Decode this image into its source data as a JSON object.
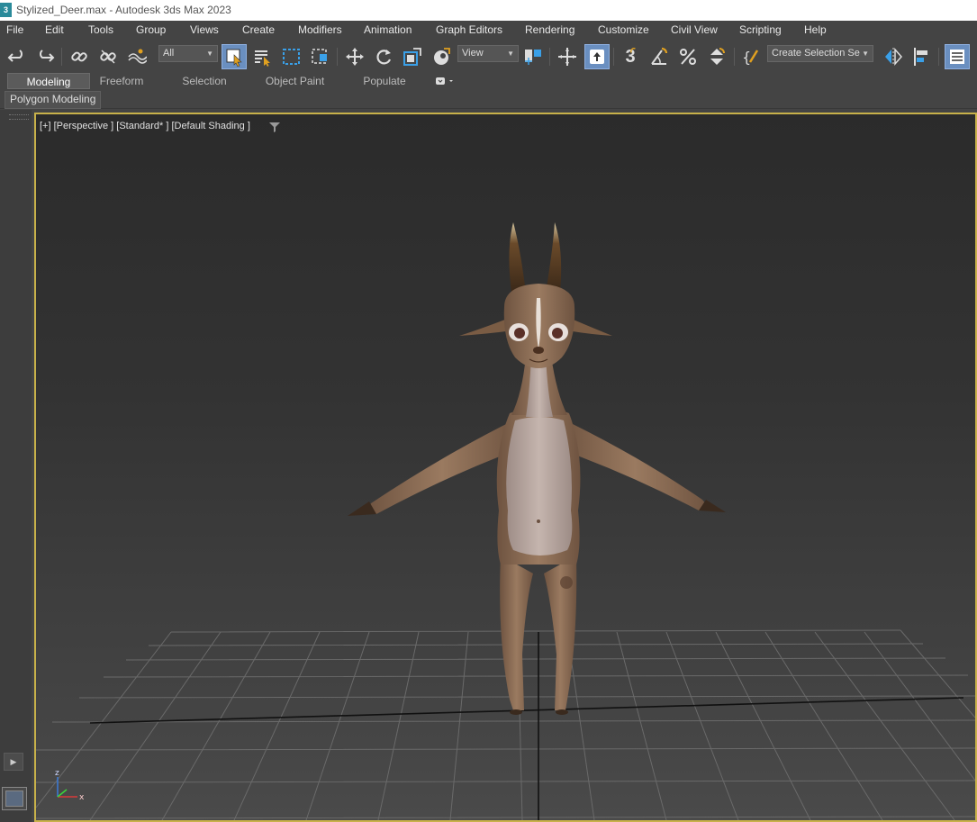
{
  "window": {
    "app_icon": "3",
    "title": "Stylized_Deer.max - Autodesk 3ds Max 2023"
  },
  "menu": [
    "File",
    "Edit",
    "Tools",
    "Group",
    "Views",
    "Create",
    "Modifiers",
    "Animation",
    "Graph Editors",
    "Rendering",
    "Customize",
    "Civil View",
    "Scripting",
    "Help"
  ],
  "toolbar": {
    "filter_dropdown": "All",
    "coord_dropdown": "View",
    "selection_set_dropdown": "Create Selection Se",
    "snap_label": "3",
    "icons": [
      "undo-icon",
      "redo-icon",
      "link-icon",
      "unlink-icon",
      "bind-spacewarp-icon",
      "select-object-icon",
      "select-by-name-icon",
      "rectangular-selection-icon",
      "window-crossing-icon",
      "move-icon",
      "rotate-icon",
      "scale-icon",
      "select-place-icon",
      "pivot-icon",
      "select-manipulate-icon",
      "snaps-toggle-icon",
      "angle-snap-icon",
      "percent-snap-icon",
      "spinner-snap-icon",
      "edit-named-sets-icon",
      "mirror-icon",
      "align-icon",
      "layer-explorer-icon"
    ]
  },
  "ribbon": {
    "tabs": [
      "Modeling",
      "Freeform",
      "Selection",
      "Object Paint",
      "Populate"
    ],
    "selected_tab": "Modeling",
    "panel_button": "Polygon Modeling"
  },
  "viewport": {
    "label": "[+] [Perspective ] [Standard* ] [Default Shading ]",
    "active_border_color": "#c8b14a",
    "axis_labels": {
      "z": "z",
      "x": "x"
    }
  },
  "colors": {
    "accent": "#6a8fc0",
    "body_brown": "#8a6a52",
    "belly": "#b4a29a"
  }
}
